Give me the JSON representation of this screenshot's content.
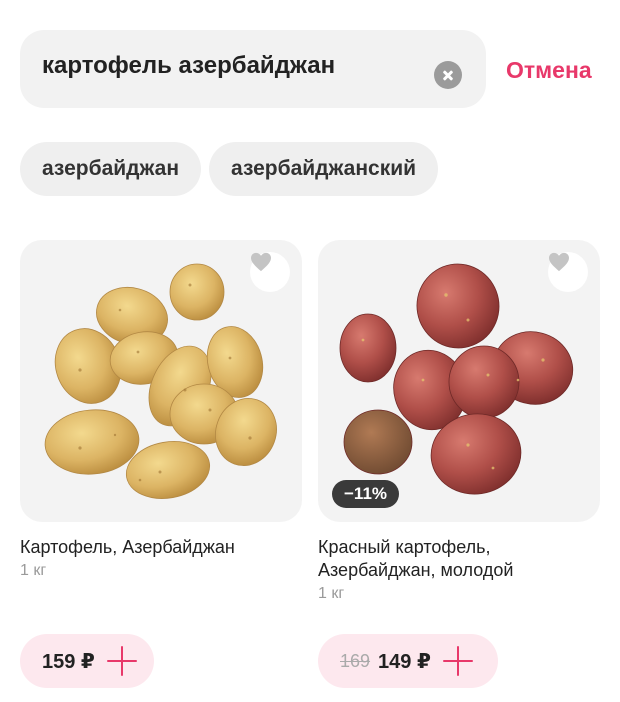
{
  "search": {
    "query": "картофель азербайджан",
    "cancel_label": "Отмена"
  },
  "suggestions": [
    "азербайджан",
    "азербайджанский"
  ],
  "products": [
    {
      "title": "Картофель, Азербайджан",
      "weight": "1 кг",
      "price": "159 ₽",
      "photo": "yellow-potatoes",
      "favorite_icon": "heart-icon"
    },
    {
      "title": "Красный картофель, Азербайджан, молодой",
      "weight": "1 кг",
      "discount": "−11%",
      "old_price": "169",
      "price": "149 ₽",
      "photo": "red-potatoes",
      "favorite_icon": "heart-icon"
    }
  ],
  "colors": {
    "accent": "#e8386a",
    "price_button_bg": "#fde8ee",
    "chip_bg": "#efefef",
    "search_bg": "#f2f2f2"
  }
}
